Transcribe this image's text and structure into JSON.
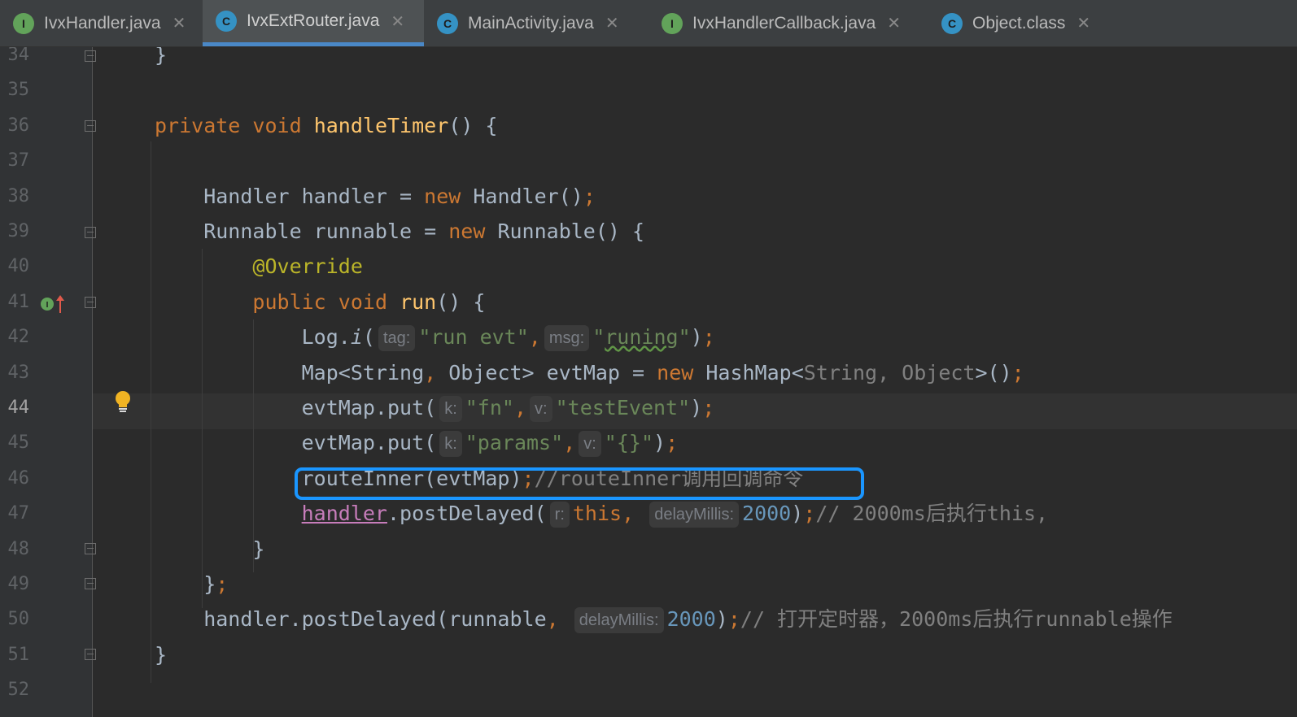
{
  "tabs": [
    {
      "label": "IvxHandler.java",
      "icon": "interface-icon",
      "icon_letter": "I",
      "active": false
    },
    {
      "label": "IvxExtRouter.java",
      "icon": "class-icon",
      "icon_letter": "C",
      "active": true
    },
    {
      "label": "MainActivity.java",
      "icon": "class-icon",
      "icon_letter": "C",
      "active": false
    },
    {
      "label": "IvxHandlerCallback.java",
      "icon": "interface-icon",
      "icon_letter": "I",
      "active": false
    },
    {
      "label": "Object.class",
      "icon": "class-icon",
      "icon_letter": "C",
      "active": false
    }
  ],
  "tab_close_glyph": "✕",
  "editor": {
    "current_line": 44,
    "lines": [
      {
        "num": "34",
        "code": [
          {
            "t": "}",
            "c": ""
          }
        ]
      },
      {
        "num": "35",
        "code": []
      },
      {
        "num": "36",
        "code": [
          {
            "t": "private",
            "c": "kw"
          },
          {
            "t": " ",
            "c": ""
          },
          {
            "t": "void",
            "c": "kw"
          },
          {
            "t": " ",
            "c": ""
          },
          {
            "t": "handleTimer",
            "c": "fn"
          },
          {
            "t": "() {",
            "c": ""
          }
        ]
      },
      {
        "num": "37",
        "code": []
      },
      {
        "num": "38",
        "code": [
          {
            "t": "    Handler handler = ",
            "c": ""
          },
          {
            "t": "new",
            "c": "kw"
          },
          {
            "t": " Handler()",
            "c": ""
          },
          {
            "t": ";",
            "c": "kw"
          }
        ]
      },
      {
        "num": "39",
        "code": [
          {
            "t": "    Runnable runnable = ",
            "c": ""
          },
          {
            "t": "new",
            "c": "kw"
          },
          {
            "t": " Runnable() {",
            "c": ""
          }
        ]
      },
      {
        "num": "40",
        "code": [
          {
            "t": "        ",
            "c": ""
          },
          {
            "t": "@Override",
            "c": "ann"
          }
        ]
      },
      {
        "num": "41",
        "code": [
          {
            "t": "        ",
            "c": ""
          },
          {
            "t": "public",
            "c": "kw"
          },
          {
            "t": " ",
            "c": ""
          },
          {
            "t": "void",
            "c": "kw"
          },
          {
            "t": " ",
            "c": ""
          },
          {
            "t": "run",
            "c": "fn"
          },
          {
            "t": "() {",
            "c": ""
          }
        ]
      },
      {
        "num": "42",
        "code": [
          {
            "t": "            Log.",
            "c": ""
          },
          {
            "t": "i",
            "c": "ital"
          },
          {
            "t": "(",
            "c": ""
          },
          {
            "hint": "tag:"
          },
          {
            "t": "\"run evt\"",
            "c": "str"
          },
          {
            "t": ",",
            "c": "kw"
          },
          {
            "hint": "msg:"
          },
          {
            "t": "\"",
            "c": "str"
          },
          {
            "t": "runing",
            "c": "str typo"
          },
          {
            "t": "\"",
            "c": "str"
          },
          {
            "t": ")",
            "c": ""
          },
          {
            "t": ";",
            "c": "kw"
          }
        ]
      },
      {
        "num": "43",
        "code": [
          {
            "t": "            Map<String",
            "c": ""
          },
          {
            "t": ",",
            "c": "kw"
          },
          {
            "t": " Object> evtMap = ",
            "c": ""
          },
          {
            "t": "new",
            "c": "kw"
          },
          {
            "t": " HashMap<",
            "c": ""
          },
          {
            "t": "String, Object",
            "c": "gen"
          },
          {
            "t": ">()",
            "c": ""
          },
          {
            "t": ";",
            "c": "kw"
          }
        ]
      },
      {
        "num": "44",
        "code": [
          {
            "t": "            evtMap.put(",
            "c": ""
          },
          {
            "hint": "k:"
          },
          {
            "t": "\"fn\"",
            "c": "str"
          },
          {
            "t": ",",
            "c": "kw"
          },
          {
            "hint": "v:"
          },
          {
            "t": "\"testEvent\"",
            "c": "str"
          },
          {
            "t": ")",
            "c": ""
          },
          {
            "t": ";",
            "c": "kw"
          }
        ]
      },
      {
        "num": "45",
        "code": [
          {
            "t": "            evtMap.put(",
            "c": ""
          },
          {
            "hint": "k:"
          },
          {
            "t": "\"params\"",
            "c": "str"
          },
          {
            "t": ",",
            "c": "kw"
          },
          {
            "hint": "v:"
          },
          {
            "t": "\"{}\"",
            "c": "str"
          },
          {
            "t": ")",
            "c": ""
          },
          {
            "t": ";",
            "c": "kw"
          }
        ]
      },
      {
        "num": "46",
        "code": [
          {
            "t": "            routeInner(evtMap)",
            "c": ""
          },
          {
            "t": ";",
            "c": "kw"
          },
          {
            "t": "//routeInner调用回调命令",
            "c": "cmt"
          }
        ]
      },
      {
        "num": "47",
        "code": [
          {
            "t": "            ",
            "c": ""
          },
          {
            "t": "handler",
            "c": "field"
          },
          {
            "t": ".postDelayed(",
            "c": ""
          },
          {
            "hint": "r:"
          },
          {
            "t": "this",
            "c": "kw"
          },
          {
            "t": ", ",
            "c": "kw"
          },
          {
            "hint": "delayMillis:"
          },
          {
            "t": "2000",
            "c": "num"
          },
          {
            "t": ")",
            "c": ""
          },
          {
            "t": ";",
            "c": "kw"
          },
          {
            "t": "// 2000ms后执行this,",
            "c": "cmt"
          }
        ]
      },
      {
        "num": "48",
        "code": [
          {
            "t": "        }",
            "c": ""
          }
        ]
      },
      {
        "num": "49",
        "code": [
          {
            "t": "    }",
            "c": ""
          },
          {
            "t": ";",
            "c": "kw"
          }
        ]
      },
      {
        "num": "50",
        "code": [
          {
            "t": "    handler.postDelayed(runnable",
            "c": ""
          },
          {
            "t": ", ",
            "c": "kw"
          },
          {
            "hint": "delayMillis:"
          },
          {
            "t": "2000",
            "c": "num"
          },
          {
            "t": ")",
            "c": ""
          },
          {
            "t": ";",
            "c": "kw"
          },
          {
            "t": "// 打开定时器，2000ms后执行runnable操作",
            "c": "cmt"
          }
        ]
      },
      {
        "num": "51",
        "code": [
          {
            "t": "}",
            "c": ""
          }
        ]
      },
      {
        "num": "52",
        "code": []
      }
    ]
  },
  "gutter_icons": {
    "line_41": "implements-method-icon",
    "line_44": "lightbulb-icon"
  },
  "highlight": {
    "line": 46,
    "color": "#1a96ff"
  }
}
